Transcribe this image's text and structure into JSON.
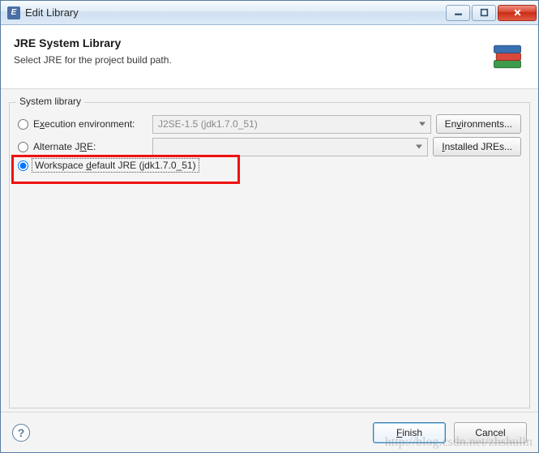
{
  "window": {
    "title": "Edit Library",
    "min_tooltip": "Minimize",
    "max_tooltip": "Maximize",
    "close_tooltip": "Close"
  },
  "header": {
    "title": "JRE System Library",
    "desc": "Select JRE for the project build path."
  },
  "group": {
    "label": "System library",
    "exec_env_label_pre": "E",
    "exec_env_label_mid": "x",
    "exec_env_label_post": "ecution environment:",
    "exec_env_value": "J2SE-1.5 (jdk1.7.0_51)",
    "environments_btn_pre": "En",
    "environments_btn_mid": "v",
    "environments_btn_post": "ironments...",
    "alt_jre_label_pre": "Alternate J",
    "alt_jre_label_mid": "R",
    "alt_jre_label_post": "E:",
    "alt_jre_value": "",
    "installed_btn_pre": "",
    "installed_btn_mid": "I",
    "installed_btn_post": "nstalled JREs...",
    "workspace_label_pre": "Workspace ",
    "workspace_label_mid": "d",
    "workspace_label_post": "efault JRE (jdk1.7.0_51)",
    "selected": "workspace"
  },
  "footer": {
    "finish_pre": "",
    "finish_mid": "F",
    "finish_post": "inish",
    "cancel": "Cancel"
  },
  "watermark": "http://blog.csdn.net/zhshulin"
}
